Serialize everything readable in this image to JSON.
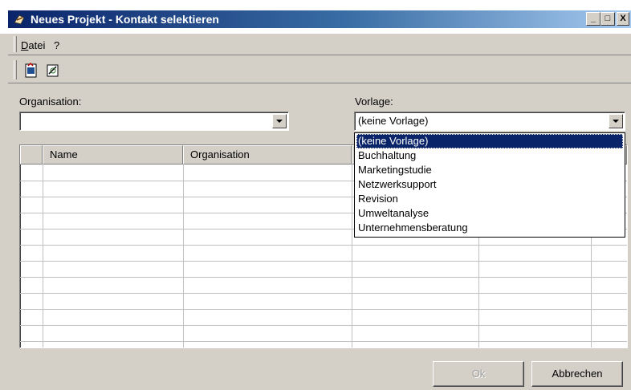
{
  "window": {
    "title": "Neues Projekt - Kontakt selektieren",
    "minimize": "_",
    "maximize": "□",
    "close": "X"
  },
  "menu": {
    "items": [
      {
        "label": "Datei",
        "mnemonic": "D"
      },
      {
        "label": "?"
      }
    ]
  },
  "toolbar": {
    "buttons": [
      {
        "icon": "new-document-icon"
      },
      {
        "icon": "edit-document-icon"
      }
    ]
  },
  "form": {
    "organisation_label": "Organisation:",
    "organisation_value": "",
    "vorlage_label": "Vorlage:",
    "vorlage_value": "(keine Vorlage)"
  },
  "grid": {
    "columns": [
      "",
      "Name",
      "Organisation",
      "",
      "",
      ""
    ],
    "rows": []
  },
  "dropdown": {
    "options": [
      "(keine Vorlage)",
      "Buchhaltung",
      "Marketingstudie",
      "Netzwerksupport",
      "Revision",
      "Umweltanalyse",
      "Unternehmensberatung"
    ],
    "selected_index": 0
  },
  "buttons": {
    "ok_label": "Ok",
    "cancel_label": "Abbrechen"
  }
}
